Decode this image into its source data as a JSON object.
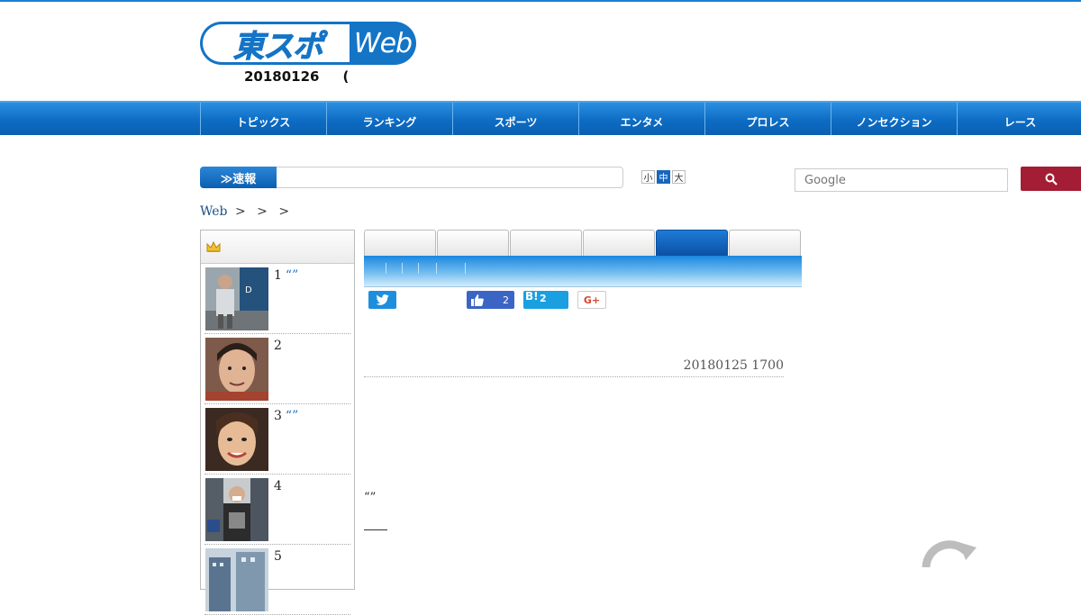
{
  "logo": {
    "left_text": "東スポ",
    "right_text": "Web"
  },
  "date_line": {
    "date": "20180126",
    "paren": "("
  },
  "nav": {
    "items": [
      {
        "label": "トピックス"
      },
      {
        "label": "ランキング"
      },
      {
        "label": "スポーツ"
      },
      {
        "label": "エンタメ"
      },
      {
        "label": "プロレス"
      },
      {
        "label": "ノンセクション"
      },
      {
        "label": "レース"
      }
    ]
  },
  "breaking": {
    "label": "≫速報"
  },
  "font_size": {
    "small": "小",
    "medium": "中",
    "large": "大"
  },
  "search": {
    "placeholder": "Google"
  },
  "breadcrumb": {
    "home": "Web",
    "sep1": ">",
    "sep2": ">",
    "sep3": ">"
  },
  "ranking": {
    "items": [
      {
        "num": "1",
        "quote": "“”"
      },
      {
        "num": "2",
        "quote": ""
      },
      {
        "num": "3",
        "quote": "“”"
      },
      {
        "num": "4",
        "quote": ""
      },
      {
        "num": "5",
        "quote": ""
      }
    ]
  },
  "share": {
    "facebook_count": "2",
    "hatena_label": "B!",
    "hatena_count": "2",
    "gplus_label": "G+"
  },
  "article": {
    "date": "20180125 1700",
    "quote": "“”"
  },
  "colors": {
    "nav_blue": "#0d6cc4",
    "brand_blue": "#1474c6",
    "search_red": "#a31d34"
  }
}
